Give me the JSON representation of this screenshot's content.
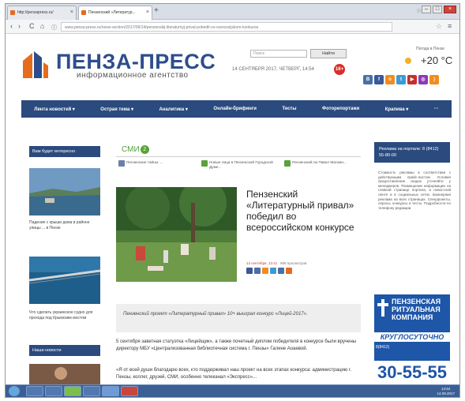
{
  "browser": {
    "tabs": [
      {
        "label": "http://penzapress.ru/",
        "active": false
      },
      {
        "label": "Пензенский «Литератур...",
        "active": true
      }
    ],
    "url": "www.penza-press.ru/news-section/2017/09/14/penzenskij-literaturnyj-prival-pobedil-vo-vserossijskom-konkurse"
  },
  "site": {
    "logo_title": "ПЕНЗА-ПРЕСС",
    "logo_subtitle": "информационное агентство",
    "search_placeholder": "Поиск",
    "search_button": "Найти",
    "dateline": "14 СЕНТЯБРЯ 2017, ЧЕТВЕРГ, 14:54",
    "age_badge": "16+",
    "weather_label": "Погода в Пензе",
    "temperature": "+20 °C",
    "social_icons": [
      "vk-icon",
      "facebook-icon",
      "odnoklassniki-icon",
      "twitter-icon",
      "youtube-icon",
      "instagram-icon",
      "rss-icon"
    ],
    "colors": {
      "brand": "#2b4a7e",
      "accent": "#e56b1f",
      "smi_green": "#5aa13b"
    }
  },
  "nav": {
    "items": [
      "Лента новостей ▾",
      "Острая тема ▾",
      "Аналитика ▾",
      "Онлайн-брифинги",
      "Тесты",
      "Фоторепортажи",
      "Крапива ▾",
      "···"
    ]
  },
  "left": {
    "heading": "Вам будет интересно",
    "story1": "Падение с крыши дома в районе улицы ... в Пензе",
    "story2": "Что сделать украинское судно для прохода под Крымским мостом",
    "heading2": "Наши новости"
  },
  "center": {
    "smi_label": "СМИ",
    "smi_count": "2",
    "news": [
      "Пензенские тайны: ...",
      "Новые лица в Пензенской Городской Думе...",
      "Пензенский ли Павел Малкин..."
    ],
    "headline": "Пензенский «Литературный привал» победил во всероссийском конкурсе",
    "meta_date": "14 сентября, 13:41",
    "meta_views": "958 просмотров",
    "lead": "Пензенский проект «Литературный привал» 10+ выиграл конкурс «Лицей-2017».",
    "body1": "5 сентября заветная статуэтка «Лицейщик», а также почетный диплом победителя в конкурсе были вручены директору МБУ «Централизованная библиотечная система г. Пензы» Галине Аоаевой.",
    "body2": "«Я от всей души благодарю всех, кто поддерживал наш проект на всех этапах конкурса: администрацию г. Пензы, коллег, друзей, СМИ, особенно телеканал «Экспресс»..."
  },
  "right": {
    "ad_heading": "Реклама на портале: 8 (8412) 55-80-00",
    "ad_text": "Стоимость рекламы в соответствии с действующим прайс-листом. Условия предоставления скидок уточняйте у менеджеров. Размещение информации на главной странице портала, в новостной ленте и в социальных сетях. Баннерная реклама на всех страницах. Спецпроекты, опросы, конкурсы и тесты. Подробности по телефону редакции.",
    "ritual_title": "ПЕНЗЕНСКАЯ РИТУАЛЬНАЯ КОМПАНИЯ",
    "ritual_banner": "КРУГЛОСУТОЧНО",
    "ritual_code": "8(8412)",
    "ritual_phone": "30-55-55"
  },
  "taskbar": {
    "time": "14:54",
    "date": "14.09.2017"
  }
}
